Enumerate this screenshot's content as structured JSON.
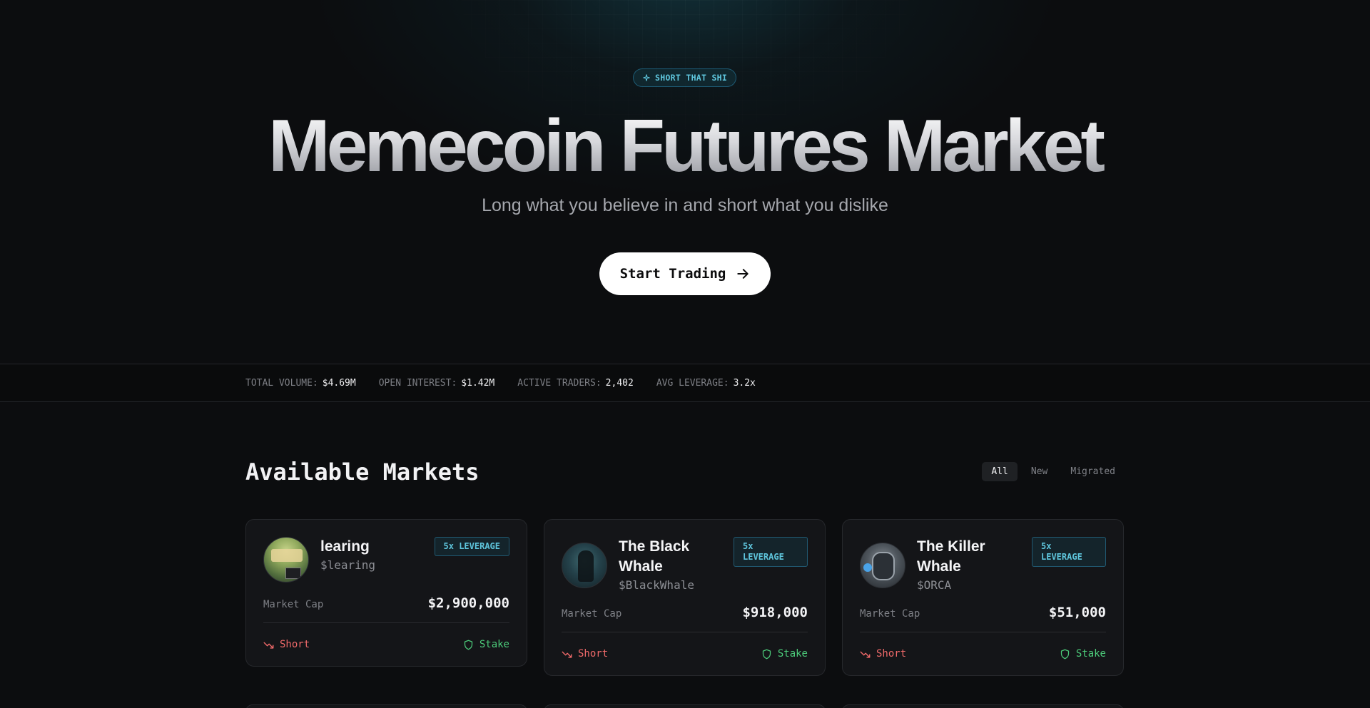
{
  "hero": {
    "badge": "SHORT THAT SHI",
    "title": "Memecoin Futures Market",
    "subtitle": "Long what you believe in and short what you dislike",
    "cta_label": "Start Trading"
  },
  "stats": [
    {
      "label": "TOTAL VOLUME:",
      "value": "$4.69M"
    },
    {
      "label": "OPEN INTEREST:",
      "value": "$1.42M"
    },
    {
      "label": "ACTIVE TRADERS:",
      "value": "2,402"
    },
    {
      "label": "AVG LEVERAGE:",
      "value": "3.2x"
    }
  ],
  "markets": {
    "title": "Available Markets",
    "filters": [
      "All",
      "New",
      "Migrated"
    ],
    "active_filter": "All",
    "mcap_label": "Market Cap",
    "short_label": "Short",
    "stake_label": "Stake",
    "items": [
      {
        "name": "learing",
        "ticker": "$learing",
        "leverage": "5x LEVERAGE",
        "market_cap": "$2,900,000"
      },
      {
        "name": "The Black Whale",
        "ticker": "$BlackWhale",
        "leverage": "5x LEVERAGE",
        "market_cap": "$918,000"
      },
      {
        "name": "The Killer Whale",
        "ticker": "$ORCA",
        "leverage": "5x LEVERAGE",
        "market_cap": "$51,000"
      }
    ]
  },
  "colors": {
    "accent": "#5fc6dd",
    "short": "#f06a6a",
    "stake": "#4ccb7a",
    "background": "#0c0d0f"
  },
  "icons": {
    "badge": "sparkle-icon",
    "cta": "arrow-right-icon",
    "short": "trending-down-icon",
    "stake": "shield-icon"
  }
}
